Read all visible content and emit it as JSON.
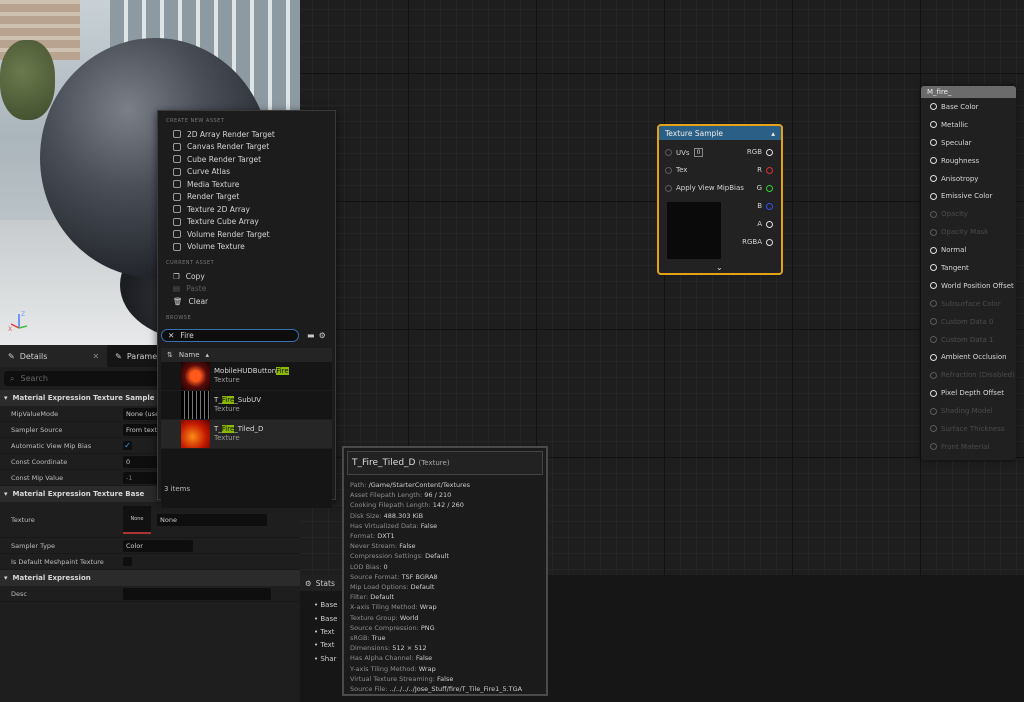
{
  "viewport": {
    "gizmo_z": "Z",
    "gizmo_x": "X"
  },
  "details": {
    "tabs": [
      {
        "label": "Details"
      },
      {
        "label": "Parameters"
      }
    ],
    "search_placeholder": "Search",
    "sections": {
      "texture_sample": "Material Expression Texture Sample",
      "texture_base": "Material Expression Texture Base",
      "expression": "Material Expression"
    },
    "rows": {
      "mip_value_mode": {
        "label": "MipValueMode",
        "value": "None (use"
      },
      "sampler_source": {
        "label": "Sampler Source",
        "value": "From textu"
      },
      "auto_view_mip_bias": {
        "label": "Automatic View Mip Bias"
      },
      "const_coordinate": {
        "label": "Const Coordinate",
        "value": "0"
      },
      "const_mip_value": {
        "label": "Const Mip Value",
        "value": "-1"
      },
      "texture": {
        "label": "Texture",
        "thumb": "None",
        "value": "None"
      },
      "sampler_type": {
        "label": "Sampler Type",
        "value": "Color"
      },
      "is_default_meshpaint": {
        "label": "Is Default Meshpaint Texture"
      },
      "desc": {
        "label": "Desc"
      }
    }
  },
  "menu": {
    "create_header": "CREATE NEW ASSET",
    "create_items": [
      "2D Array Render Target",
      "Canvas Render Target",
      "Cube Render Target",
      "Curve Atlas",
      "Media Texture",
      "Render Target",
      "Texture 2D Array",
      "Texture Cube Array",
      "Volume Render Target",
      "Volume Texture"
    ],
    "current_header": "CURRENT ASSET",
    "copy": "Copy",
    "paste": "Paste",
    "clear": "Clear",
    "browse_header": "BROWSE",
    "search_value": "Fire",
    "column_name": "Name",
    "assets": [
      {
        "pre": "MobileHUDButton",
        "match": "Fire",
        "post": "",
        "type": "Texture"
      },
      {
        "pre": "T_",
        "match": "Fire",
        "post": "_SubUV",
        "type": "Texture"
      },
      {
        "pre": "T_",
        "match": "Fire",
        "post": "_Tiled_D",
        "type": "Texture"
      }
    ],
    "count": "3 items"
  },
  "texture_node": {
    "title": "Texture Sample",
    "uvs": "UVs",
    "uvs_value": "0",
    "tex": "Tex",
    "apply_mip": "Apply View MipBias",
    "outputs": [
      "RGB",
      "R",
      "G",
      "B",
      "A",
      "RGBA"
    ],
    "colors": {
      "r": "#e03030",
      "g": "#30d030",
      "b": "#3050ff",
      "frame": "#e4a316",
      "header": "#2c5f86"
    }
  },
  "material_node": {
    "title": "M_fire_",
    "pins": [
      {
        "label": "Base Color",
        "on": true
      },
      {
        "label": "Metallic",
        "on": true
      },
      {
        "label": "Specular",
        "on": true
      },
      {
        "label": "Roughness",
        "on": true
      },
      {
        "label": "Anisotropy",
        "on": true
      },
      {
        "label": "Emissive Color",
        "on": true
      },
      {
        "label": "Opacity",
        "on": false
      },
      {
        "label": "Opacity Mask",
        "on": false
      },
      {
        "label": "Normal",
        "on": true
      },
      {
        "label": "Tangent",
        "on": true
      },
      {
        "label": "World Position Offset",
        "on": true
      },
      {
        "label": "Subsurface Color",
        "on": false
      },
      {
        "label": "Custom Data 0",
        "on": false
      },
      {
        "label": "Custom Data 1",
        "on": false
      },
      {
        "label": "Ambient Occlusion",
        "on": true
      },
      {
        "label": "Refraction (Disabled)",
        "on": false
      },
      {
        "label": "Pixel Depth Offset",
        "on": true
      },
      {
        "label": "Shading Model",
        "on": false
      },
      {
        "label": "Surface Thickness",
        "on": false
      },
      {
        "label": "Front Material",
        "on": false
      }
    ]
  },
  "tooltip": {
    "title": "T_Fire_Tiled_D",
    "type": "(Texture)",
    "lines": [
      {
        "k": "Path:",
        "v": "/Game/StarterContent/Textures"
      },
      {
        "k": "Asset Filepath Length:",
        "v": "96 / 210"
      },
      {
        "k": "Cooking Filepath Length:",
        "v": "142 / 260"
      },
      {
        "k": "Disk Size:",
        "v": "488.303 KiB"
      },
      {
        "k": "Has Virtualized Data:",
        "v": "False"
      },
      {
        "k": "Format:",
        "v": "DXT1"
      },
      {
        "k": "Never Stream:",
        "v": "False"
      },
      {
        "k": "Compression Settings:",
        "v": "Default"
      },
      {
        "k": "LOD Bias:",
        "v": "0"
      },
      {
        "k": "Source Format:",
        "v": "TSF BGRA8"
      },
      {
        "k": "Mip Load Options:",
        "v": "Default"
      },
      {
        "k": "Filter:",
        "v": "Default"
      },
      {
        "k": "X-axis Tiling Method:",
        "v": "Wrap"
      },
      {
        "k": "Texture Group:",
        "v": "World"
      },
      {
        "k": "Source Compression:",
        "v": "PNG"
      },
      {
        "k": "sRGB:",
        "v": "True"
      },
      {
        "k": "Dimensions:",
        "v": "512 × 512"
      },
      {
        "k": "Has Alpha Channel:",
        "v": "False"
      },
      {
        "k": "Y-axis Tiling Method:",
        "v": "Wrap"
      },
      {
        "k": "Virtual Texture Streaming:",
        "v": "False"
      },
      {
        "k": "Source File:",
        "v": "../../../../Jose_Stuff/fire/T_Tile_Fire1_5.TGA"
      }
    ]
  },
  "stats": {
    "tab": "Stats",
    "bullets": [
      "Base",
      "Base",
      "Text",
      "Text",
      "Shar"
    ]
  }
}
